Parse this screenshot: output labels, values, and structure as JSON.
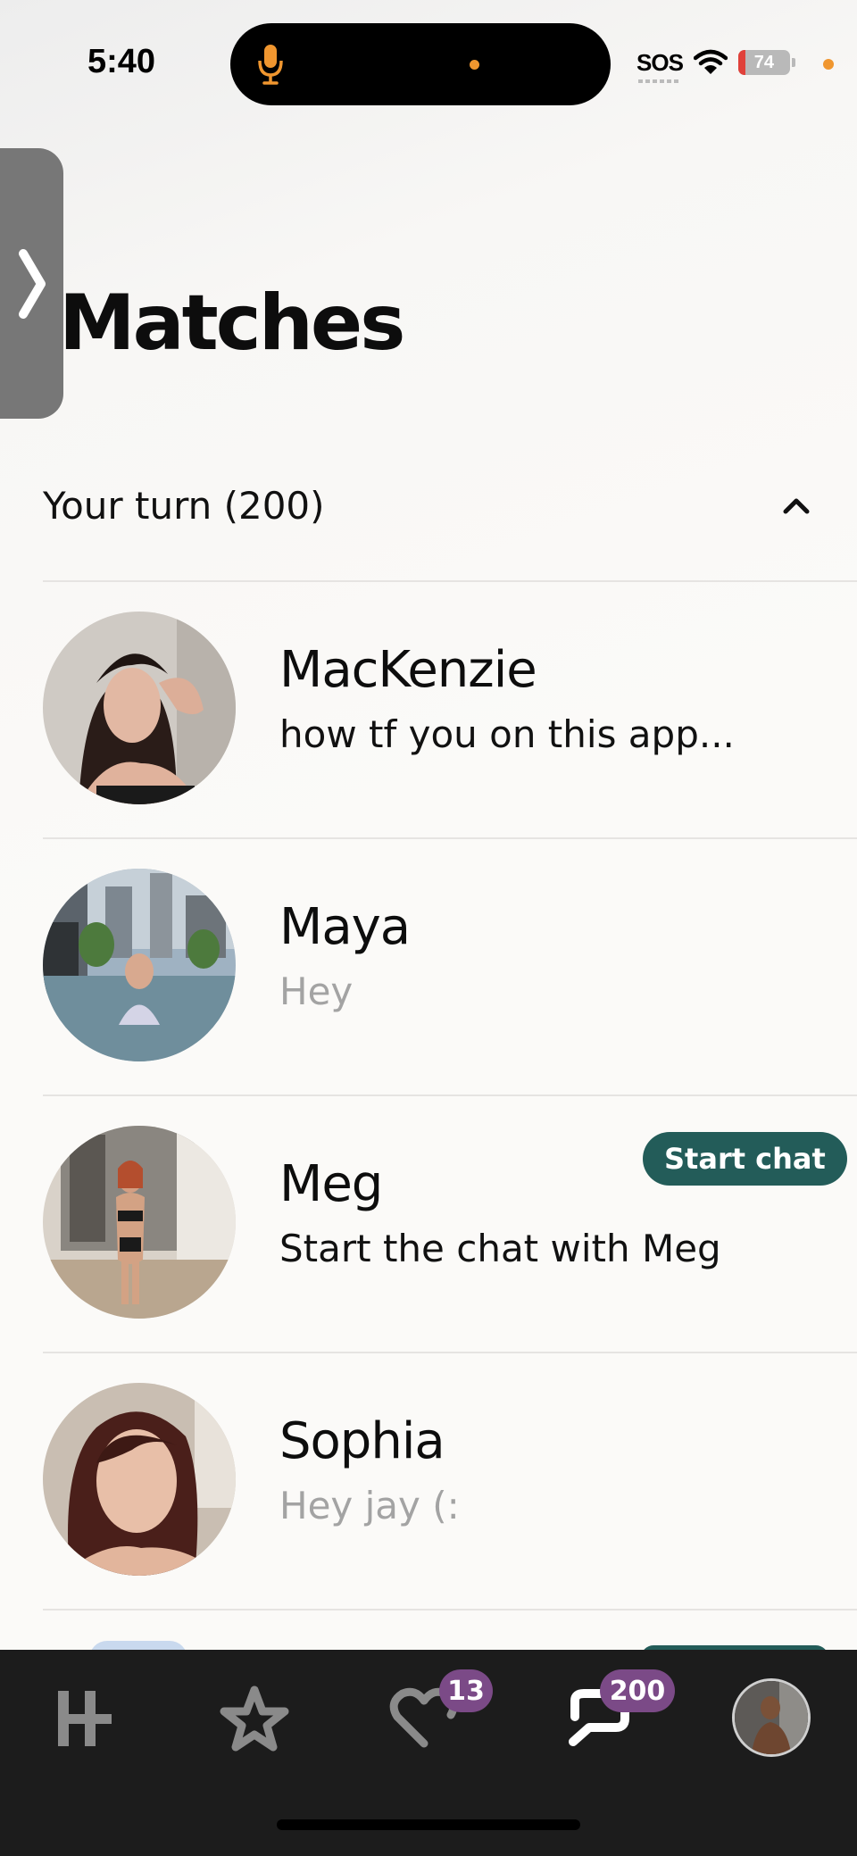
{
  "status_bar": {
    "time": "5:40",
    "carrier": "SOS",
    "battery_level": "74",
    "icons": [
      "microphone-icon",
      "wifi-icon",
      "battery-icon"
    ]
  },
  "side_tab": {
    "icon": "chevron-right-icon"
  },
  "page": {
    "title": "Matches"
  },
  "section": {
    "title": "Your turn (200)",
    "toggle_icon": "chevron-up-icon"
  },
  "matches": [
    {
      "name": "MacKenzie",
      "preview": "how tf you on this app...",
      "preview_style": "unread",
      "badge": ""
    },
    {
      "name": "Maya",
      "preview": "Hey",
      "preview_style": "read",
      "badge": ""
    },
    {
      "name": "Meg",
      "preview": "Start the chat with Meg",
      "preview_style": "unread",
      "badge": "Start chat"
    },
    {
      "name": "Sophia",
      "preview": "Hey jay (:",
      "preview_style": "read",
      "badge": ""
    }
  ],
  "bottom_nav": {
    "items": [
      {
        "name": "discover",
        "icon": "hinge-h-icon"
      },
      {
        "name": "standouts",
        "icon": "star-icon"
      },
      {
        "name": "likes",
        "icon": "heart-icon",
        "badge": "13"
      },
      {
        "name": "matches",
        "icon": "chat-icon",
        "badge": "200",
        "active": true
      },
      {
        "name": "profile",
        "icon": "avatar-icon"
      }
    ]
  },
  "colors": {
    "badge_green": "#235c59",
    "nav_badge_purple": "#7b4a87",
    "nav_background": "#1c1c1c",
    "muted_text": "#a3a3a3"
  }
}
